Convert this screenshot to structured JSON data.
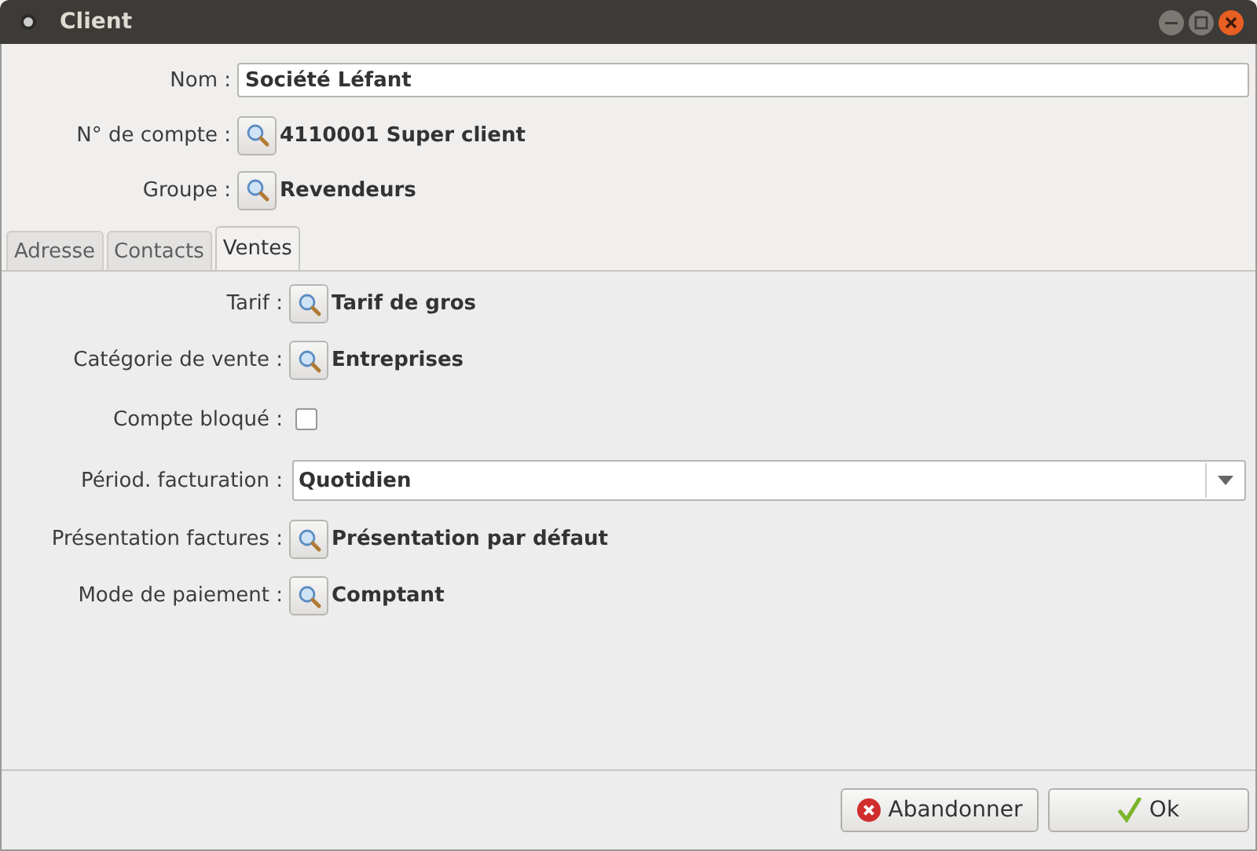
{
  "window": {
    "title": "Client"
  },
  "header_fields": [
    {
      "kind": "text",
      "label": "Nom :",
      "value": "Société Léfant"
    },
    {
      "kind": "lookup",
      "label": "N° de compte :",
      "value": "4110001 Super client"
    },
    {
      "kind": "lookup",
      "label": "Groupe :",
      "value": "Revendeurs"
    }
  ],
  "tabs": [
    {
      "label": "Adresse",
      "selected": false
    },
    {
      "label": "Contacts",
      "selected": false
    },
    {
      "label": "Ventes",
      "selected": true
    }
  ],
  "tab_fields": [
    {
      "kind": "lookup",
      "label": "Tarif :",
      "value": "Tarif de gros"
    },
    {
      "kind": "lookup",
      "label": "Catégorie de vente :",
      "value": "Entreprises"
    },
    {
      "kind": "checkbox",
      "label": "Compte bloqué :",
      "checked": false
    },
    {
      "kind": "combo",
      "label": "Périod. facturation :",
      "value": "Quotidien"
    },
    {
      "kind": "lookup",
      "label": "Présentation factures :",
      "value": "Présentation par défaut"
    },
    {
      "kind": "lookup",
      "label": "Mode de paiement :",
      "value": "Comptant"
    }
  ],
  "buttons": [
    {
      "kind": "cancel",
      "label": "Abandonner"
    },
    {
      "kind": "ok",
      "label": "Ok"
    }
  ]
}
